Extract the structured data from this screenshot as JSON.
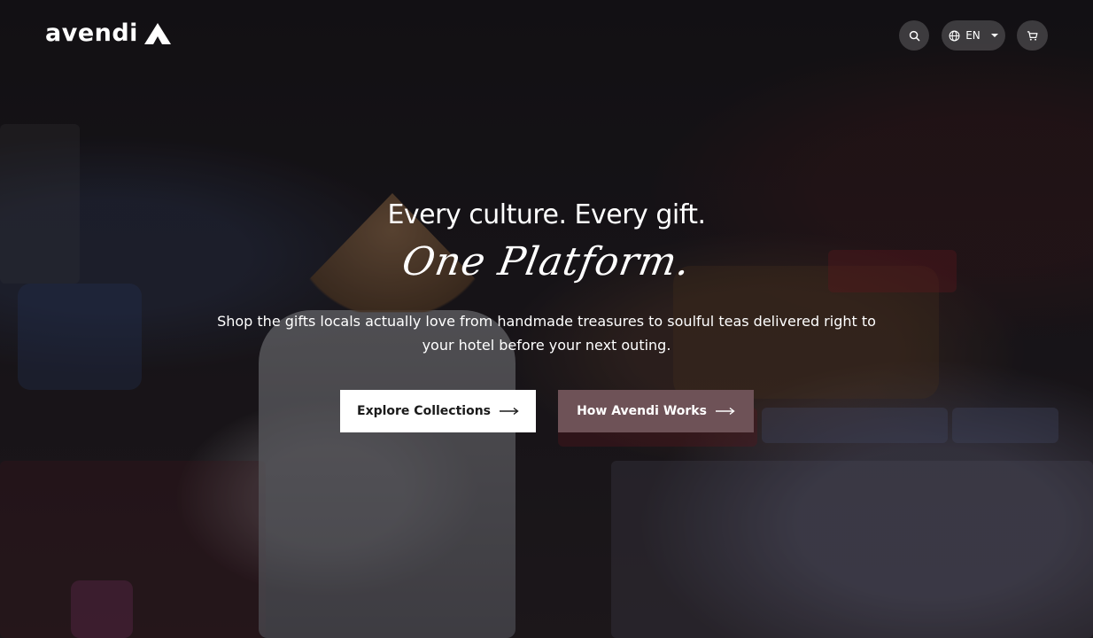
{
  "brand": {
    "name": "avendi",
    "logo_mark": "triangle-logo-mark"
  },
  "header": {
    "language": "EN",
    "icons": {
      "search": "search-icon",
      "globe": "globe-icon",
      "caret": "caret-down-icon",
      "cart": "cart-icon"
    }
  },
  "hero": {
    "headline": "Every culture. Every gift.",
    "script_line": "One Platform.",
    "subtitle": "Shop the gifts locals actually love from handmade treasures to soulful teas delivered right to your hotel before your next outing.",
    "primary_cta": "Explore Collections",
    "secondary_cta": "How Avendi Works",
    "arrow_icon": "arrow-right-icon"
  },
  "colors": {
    "overlay": "#0c0a0e",
    "secondary_cta_bg": "#6e5257",
    "primary_cta_bg": "#ffffff",
    "text": "#ffffff"
  }
}
